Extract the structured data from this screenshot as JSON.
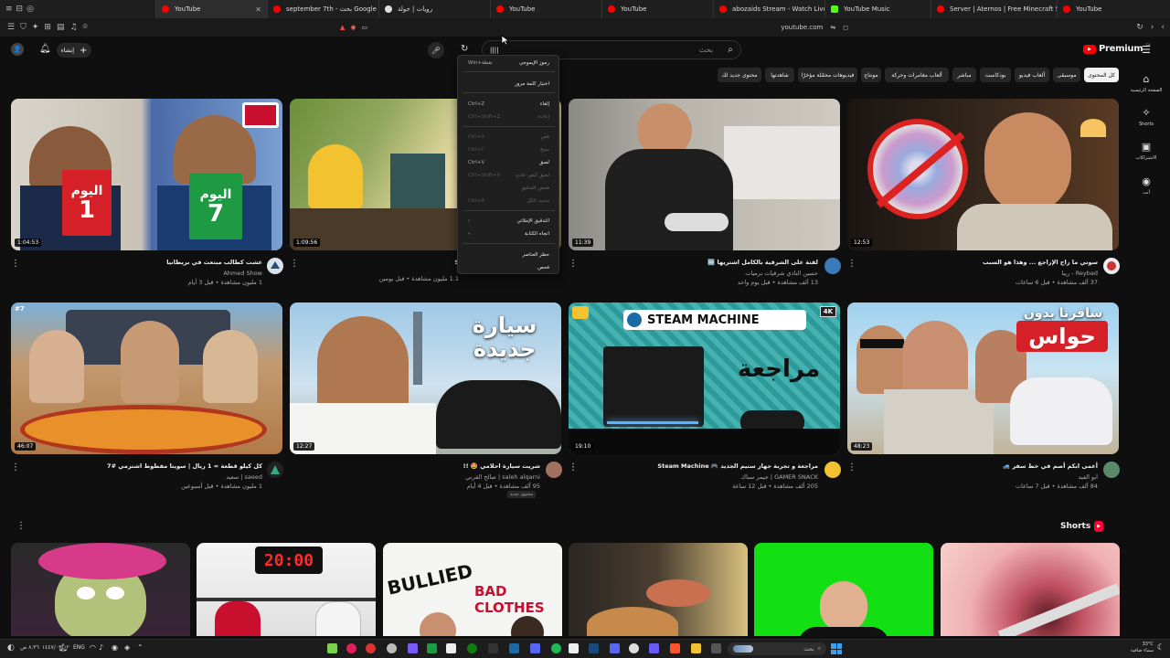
{
  "browser": {
    "tabs": [
      {
        "title": "YouTube",
        "color": "#ff0000",
        "active": true
      },
      {
        "title": "september 7th - بحث Google",
        "color": "#4285f4"
      },
      {
        "title": "رويات | جولة",
        "color": "#ff3d3d"
      },
      {
        "title": "YouTube",
        "color": "#ff0000"
      },
      {
        "title": "YouTube",
        "color": "#ff0000"
      },
      {
        "title": "abozaids Stream - Watch Live on Kick",
        "color": "#53fc18"
      },
      {
        "title": "YouTube Music",
        "color": "#ff0000"
      },
      {
        "title": "Server | Aternos | Free Minecraft Serv",
        "color": "#d33"
      },
      {
        "title": "YouTube",
        "color": "#ff0000"
      }
    ],
    "url": "youtube.com",
    "new_tab_icon": "plus-icon"
  },
  "header": {
    "logo": "Premium",
    "logo_sup": "SA",
    "create_label": "إنشاء",
    "search_placeholder": "بحث",
    "search_value": "||||"
  },
  "chips": [
    {
      "label": "كل المحتوى",
      "active": true
    },
    {
      "label": "موسيقى"
    },
    {
      "label": "ألعاب فيديو"
    },
    {
      "label": "بودكاست"
    },
    {
      "label": "مباشر"
    },
    {
      "label": "ألعاب مغامرات وحركة"
    },
    {
      "label": "مونتاج"
    },
    {
      "label": "فيديوهات محمّلة مؤخرًا"
    },
    {
      "label": "شاهدتها"
    },
    {
      "label": "محتوى جديد لك"
    }
  ],
  "context_menu": [
    {
      "label": "رموز الإيموجي",
      "shortcut": "Win+نقطة"
    },
    {
      "label": "اختيار كلمة مرور",
      "shortcut": ""
    },
    {
      "label": "إلغاء",
      "shortcut": "Ctrl+Z"
    },
    {
      "label": "إعادة",
      "shortcut": "Ctrl+Shift+Z"
    },
    {
      "label": "قص",
      "shortcut": "Ctrl+X"
    },
    {
      "label": "نسخ",
      "shortcut": "Ctrl+C"
    },
    {
      "label": "لصق",
      "shortcut": "Ctrl+V"
    },
    {
      "label": "لصق كنص عادي",
      "shortcut": "Ctrl+Shift+V"
    },
    {
      "label": "فحص التدقيق",
      "shortcut": ""
    },
    {
      "label": "تحديد الكل",
      "shortcut": "Ctrl+A"
    },
    {
      "label": "التدقيق الإملائي",
      "shortcut": ""
    },
    {
      "label": "اتجاه الكتابة",
      "shortcut": ""
    },
    {
      "label": "حظر العناصر",
      "shortcut": ""
    },
    {
      "label": "فحص",
      "shortcut": ""
    }
  ],
  "videos": [
    {
      "title": "عشت كطالب مبتعث في بريطانيا",
      "channel": "Ahmed Show",
      "stats": "1 مليون مشاهدة • قبل 3 أيام",
      "duration": "1:04:53",
      "thumb_text_a": "اليوم",
      "thumb_num_a": "1",
      "thumb_text_b": "اليوم",
      "thumb_num_b": "7"
    },
    {
      "title": "S",
      "channel": "",
      "stats": "1.1 مليون مشاهدة • قبل يومين",
      "duration": "1:09:56"
    },
    {
      "title": "لقنة على الشرقية بالكامل اشتريها 🆕",
      "channel": "حسين النادي شرقيات برميات",
      "stats": "13 ألف مشاهدة • قبل يوم واحد",
      "duration": "11:39"
    },
    {
      "title": "سوني ما راح الإراجع ... وهذا هو السبب",
      "channel": "Reybad - ريبا",
      "stats": "37 ألف مشاهدة • قبل 6 ساعات",
      "duration": "12:53"
    },
    {
      "title": "كل كيلو قطعة = 1 ريال | سويتا مفطوط اشترمي #7",
      "channel": "saeed | سعيد",
      "stats": "1 مليون مشاهدة • قبل أسبوعين",
      "duration": "46:07"
    },
    {
      "title": "شريت سيارة احلامي 🤩 !!",
      "channel": "saleh alqarni | صالح القرني",
      "stats": "95 ألف مشاهدة • قبل 4 أيام",
      "duration": "12:27",
      "badge": "محتوى جديد",
      "thumb_text": "سيارة جديدة"
    },
    {
      "title": "مراجعة و تجربة جهاز ستيم الجديد 🎮 Steam Machine",
      "channel": "GAMER SNACK | جيمر سناك",
      "stats": "205 ألف مشاهدة • قبل 12 ساعة",
      "duration": "19:10",
      "thumb_text": "STEAM MACHINE",
      "thumb_text2": "مراجعة",
      "thumb_badge": "4K"
    },
    {
      "title": "أعمى ابكم أصم في خط سفر 🚙",
      "channel": "ابو الفيد",
      "stats": "84 ألف مشاهدة • قبل 7 ساعات",
      "duration": "48:23",
      "thumb_text": "سافرنا بدون",
      "thumb_text2": "حواس"
    }
  ],
  "shorts": {
    "title": "Shorts",
    "items": [
      {
        "label": ""
      },
      {
        "label": "20:00"
      },
      {
        "label": "BULLIED"
      },
      {
        "label": ""
      },
      {
        "label": ""
      },
      {
        "label": ""
      }
    ],
    "bullied_text_2": "BAD CLOTHES"
  },
  "rail": [
    {
      "label": "الصفحة الرئيسية",
      "icon": "home-icon"
    },
    {
      "label": "Shorts",
      "icon": "shorts-icon"
    },
    {
      "label": "الاشتراكات",
      "icon": "subscriptions-icon"
    },
    {
      "label": "أنت",
      "icon": "you-icon"
    }
  ],
  "taskbar": {
    "lang": "ENG",
    "search": "بحث",
    "time": "٨:٣٦ ص",
    "date": "١٤٤٧/٠٣/٠٢",
    "weather": "33°C",
    "weather_desc": "سماء صافية"
  }
}
